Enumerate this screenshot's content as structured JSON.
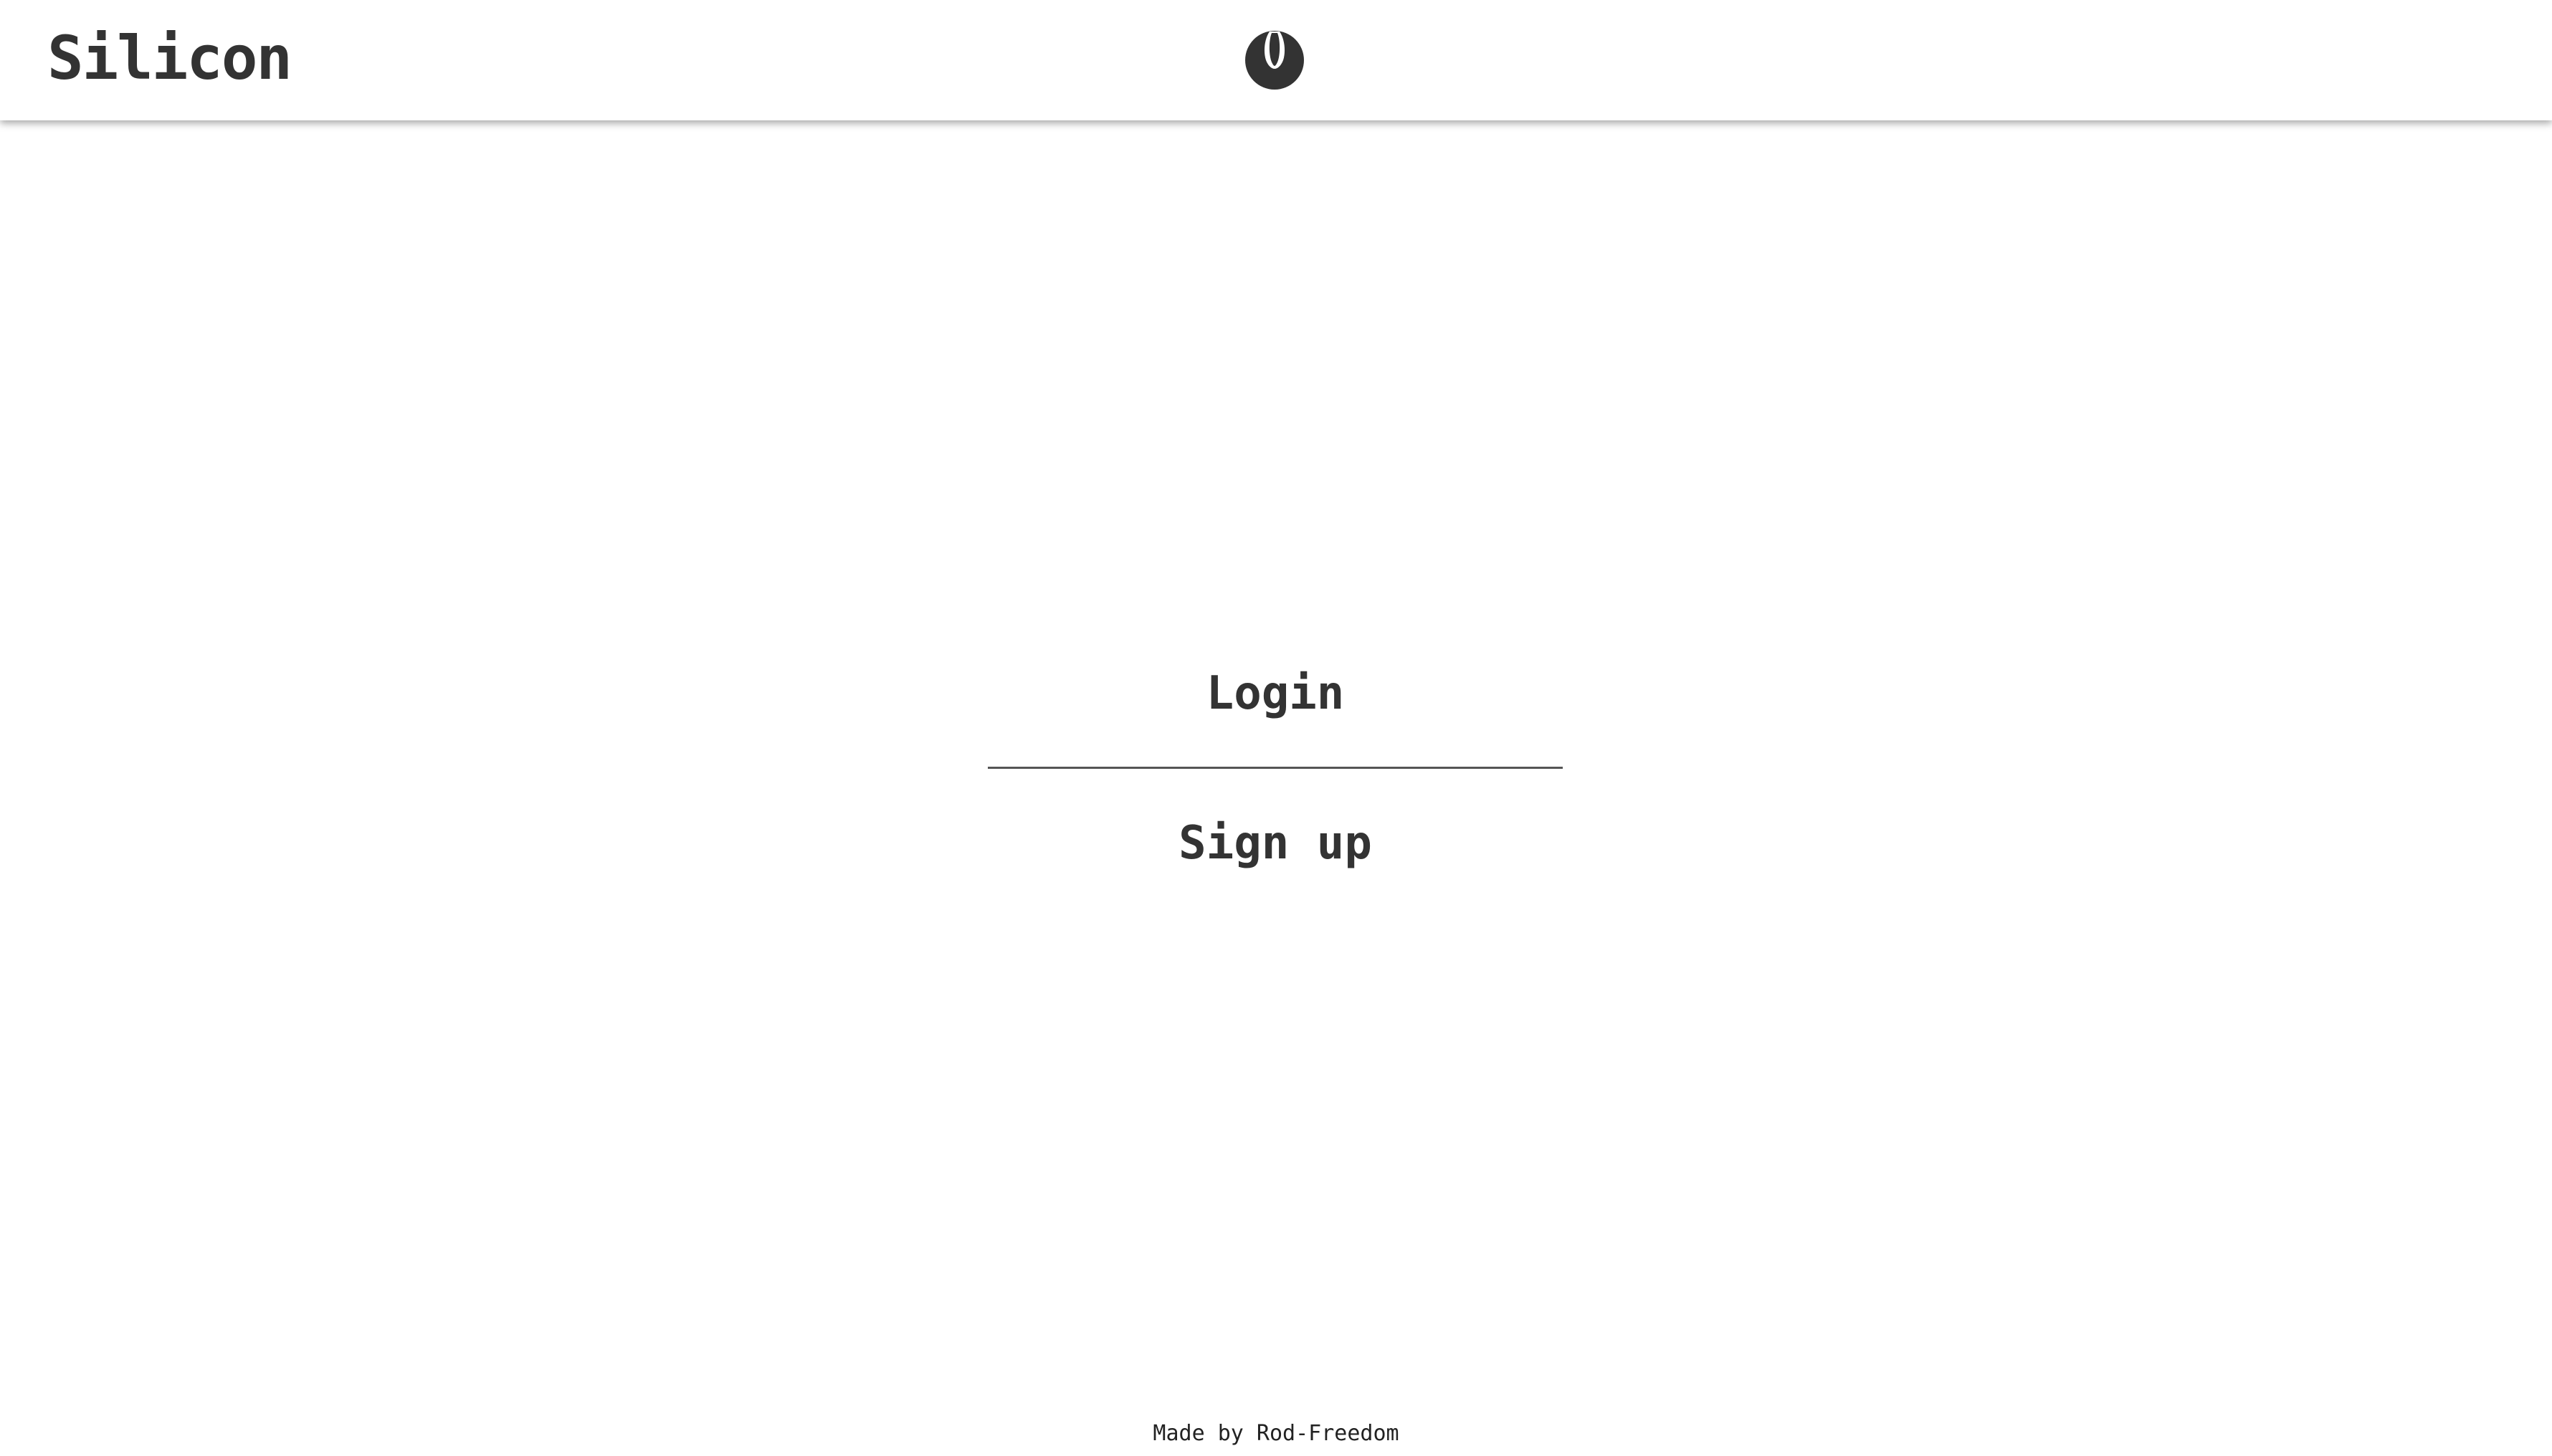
{
  "header": {
    "brand": "Silicon",
    "logo_icon": "helmet-icon"
  },
  "menu": {
    "login_label": "Login",
    "signup_label": "Sign up"
  },
  "footer": {
    "credit": "Made by Rod-Freedom"
  },
  "colors": {
    "text": "#333333",
    "background": "#ffffff",
    "divider": "#555555"
  }
}
